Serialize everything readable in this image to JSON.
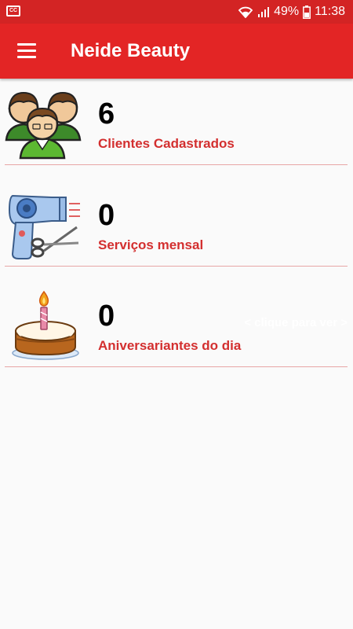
{
  "status_bar": {
    "battery_level": "49%",
    "time": "11:38",
    "notification_icon": "cc-icon"
  },
  "app_bar": {
    "title": "Neide Beauty",
    "menu_icon": "hamburger-menu-icon"
  },
  "cards": [
    {
      "count": "6",
      "label": "Clientes Cadastrados",
      "icon": "people-group-icon"
    },
    {
      "count": "0",
      "label": "Serviços mensal",
      "icon": "hairdryer-scissors-icon"
    },
    {
      "count": "0",
      "label": "Aniversariantes do dia",
      "icon": "birthday-cake-icon",
      "hint": "< clique para ver >"
    }
  ],
  "colors": {
    "status_bar": "#d32424",
    "app_bar": "#e32525",
    "label_red": "#d32f2f",
    "divider": "#e8a6a6",
    "background": "#fafafa"
  }
}
